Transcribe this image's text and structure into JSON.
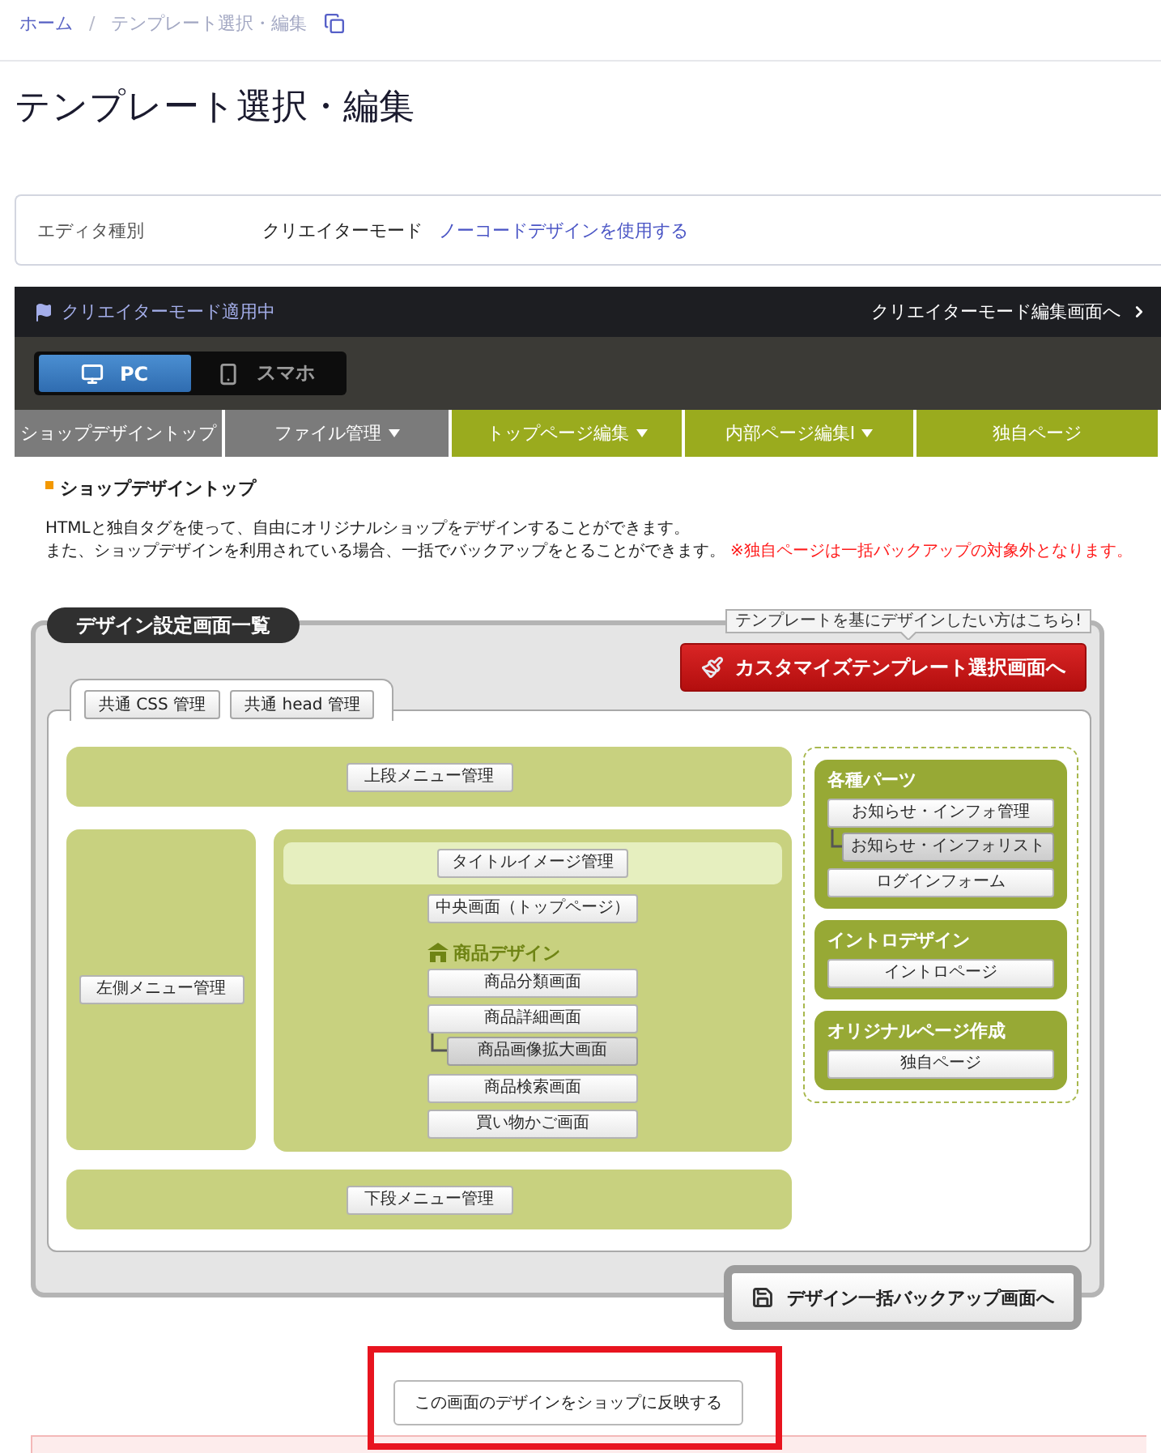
{
  "breadcrumb": {
    "items": [
      {
        "label": "ホーム",
        "current": false
      },
      {
        "label": "テンプレート選択・編集",
        "current": true
      }
    ],
    "separator": "/"
  },
  "page_title": "テンプレート選択・編集",
  "editor": {
    "label": "エディタ種別",
    "value": "クリエイターモード",
    "link": "ノーコードデザインを使用する"
  },
  "mode_bar": {
    "status": "クリエイターモード適用中",
    "link": "クリエイターモード編集画面へ"
  },
  "device_toggle": [
    {
      "kind": "desktop",
      "label": "PC",
      "selected": true
    },
    {
      "kind": "mobile",
      "label": "スマホ",
      "selected": false
    }
  ],
  "menu_tabs": [
    {
      "label": "ショップデザイントップ",
      "color": "#7b7b7b",
      "dropdown": false
    },
    {
      "label": "ファイル管理",
      "color": "#7b7b7b",
      "dropdown": true
    },
    {
      "label": "トップページ編集",
      "color": "#9aab1e",
      "dropdown": true
    },
    {
      "label": "内部ページ編集Ⅰ",
      "color": "#9aab1e",
      "dropdown": true
    },
    {
      "label": "独自ページ",
      "color": "#9aab1e",
      "dropdown": false
    }
  ],
  "section": {
    "heading": "ショップデザイントップ",
    "lines": [
      "HTMLと独自タグを使って、自由にオリジナルショップをデザインすることができます。",
      "また、ショップデザインを利用されている場合、一括でバックアップをとることができます。"
    ],
    "warning": "※独自ページは一括バックアップの対象外となります。"
  },
  "design_panel": {
    "title": "デザイン設定画面一覧",
    "tooltip": "テンプレートを基にデザインしたい方はこちら!",
    "template_button": "カスタマイズテンプレート選択画面へ",
    "tab_buttons": [
      "共通 CSS 管理",
      "共通 head 管理"
    ],
    "top_block": "上段メニュー管理",
    "left_block": "左側メニュー管理",
    "center_block": {
      "title_button": "タイトルイメージ管理",
      "main_button": "中央画面（トップページ）",
      "product_heading": "商品デザイン",
      "product_buttons": [
        {
          "label": "商品分類画面"
        },
        {
          "label": "商品詳細画面",
          "children": [
            {
              "label": "商品画像拡大画面"
            }
          ]
        },
        {
          "label": "商品検索画面"
        },
        {
          "label": "買い物かご画面"
        }
      ]
    },
    "bottom_block": "下段メニュー管理",
    "side_sections": [
      {
        "title": "各種パーツ",
        "buttons": [
          {
            "label": "お知らせ・インフォ管理",
            "children": [
              {
                "label": "お知らせ・インフォリスト"
              }
            ]
          },
          {
            "label": "ログインフォーム"
          }
        ]
      },
      {
        "title": "イントロデザイン",
        "buttons": [
          {
            "label": "イントロページ"
          }
        ]
      },
      {
        "title": "オリジナルページ作成",
        "buttons": [
          {
            "label": "独自ページ"
          }
        ]
      }
    ],
    "backup_button": "デザイン一括バックアップ画面へ"
  },
  "apply_button": {
    "label": "この画面のデザインをショップに反映する",
    "highlighted": true
  }
}
